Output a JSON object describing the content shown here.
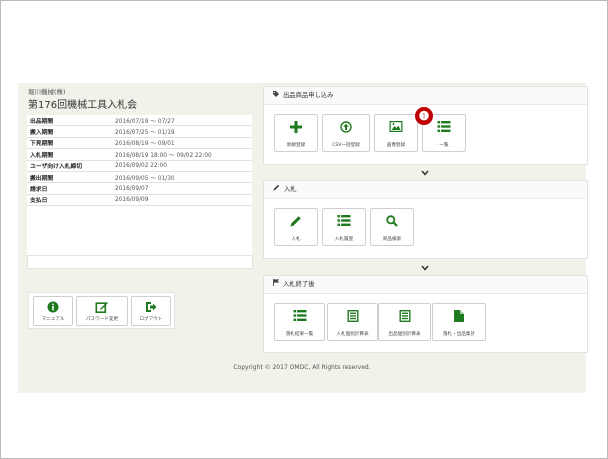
{
  "company": "堀川機械(株)",
  "auction_title": "第176回機械工具入札会",
  "schedule": [
    {
      "label": "出品期間",
      "value": "2016/07/19 ～ 07/27"
    },
    {
      "label": "搬入期間",
      "value": "2016/07/25 ～ 01/19"
    },
    {
      "label": "下見期間",
      "value": "2016/08/19 ～ 09/01"
    },
    {
      "label": "入札期間",
      "value": "2016/08/19 18:00 ～ 09/02 22:00"
    },
    {
      "label": "ユーザ向け入札締切",
      "value": "2016/09/02 22:00"
    },
    {
      "label": "搬出期間",
      "value": "2016/09/05 ～ 01/30"
    },
    {
      "label": "請求日",
      "value": "2016/09/07"
    },
    {
      "label": "支払日",
      "value": "2016/09/09"
    }
  ],
  "left_buttons": [
    {
      "label": "マニュアル",
      "icon": "info-icon"
    },
    {
      "label": "パスワード変更",
      "icon": "edit-icon"
    },
    {
      "label": "ログアウト",
      "icon": "logout-icon"
    }
  ],
  "sections": [
    {
      "title": "出品商品申し込み",
      "icon": "tag-icon",
      "buttons": [
        {
          "label": "新規登録",
          "icon": "plus-icon"
        },
        {
          "label": "CSV一括登録",
          "icon": "upload-icon"
        },
        {
          "label": "画像登録",
          "icon": "image-icon"
        },
        {
          "label": "一覧",
          "icon": "list-icon"
        }
      ]
    },
    {
      "title": "入札",
      "icon": "pencil-icon",
      "buttons": [
        {
          "label": "入札",
          "icon": "pencil-icon"
        },
        {
          "label": "入札履歴",
          "icon": "list-icon"
        },
        {
          "label": "商品検索",
          "icon": "search-icon"
        }
      ]
    },
    {
      "title": "入札終了後",
      "icon": "flag-icon",
      "buttons": [
        {
          "label": "落札結果一覧",
          "icon": "list-icon"
        },
        {
          "label": "入札個別計算表",
          "icon": "calc-icon"
        },
        {
          "label": "出品個別計算表",
          "icon": "calc-icon"
        },
        {
          "label": "落札・出品集計",
          "icon": "file-icon"
        }
      ]
    }
  ],
  "annotation_marker": "❶",
  "footer": "Copyright © 2017 OMDC, All Rights reserved.",
  "colors": {
    "accent_green": "#1f7a1f",
    "marker_red": "#c00000",
    "panel_bg": "#f1f2ea"
  }
}
